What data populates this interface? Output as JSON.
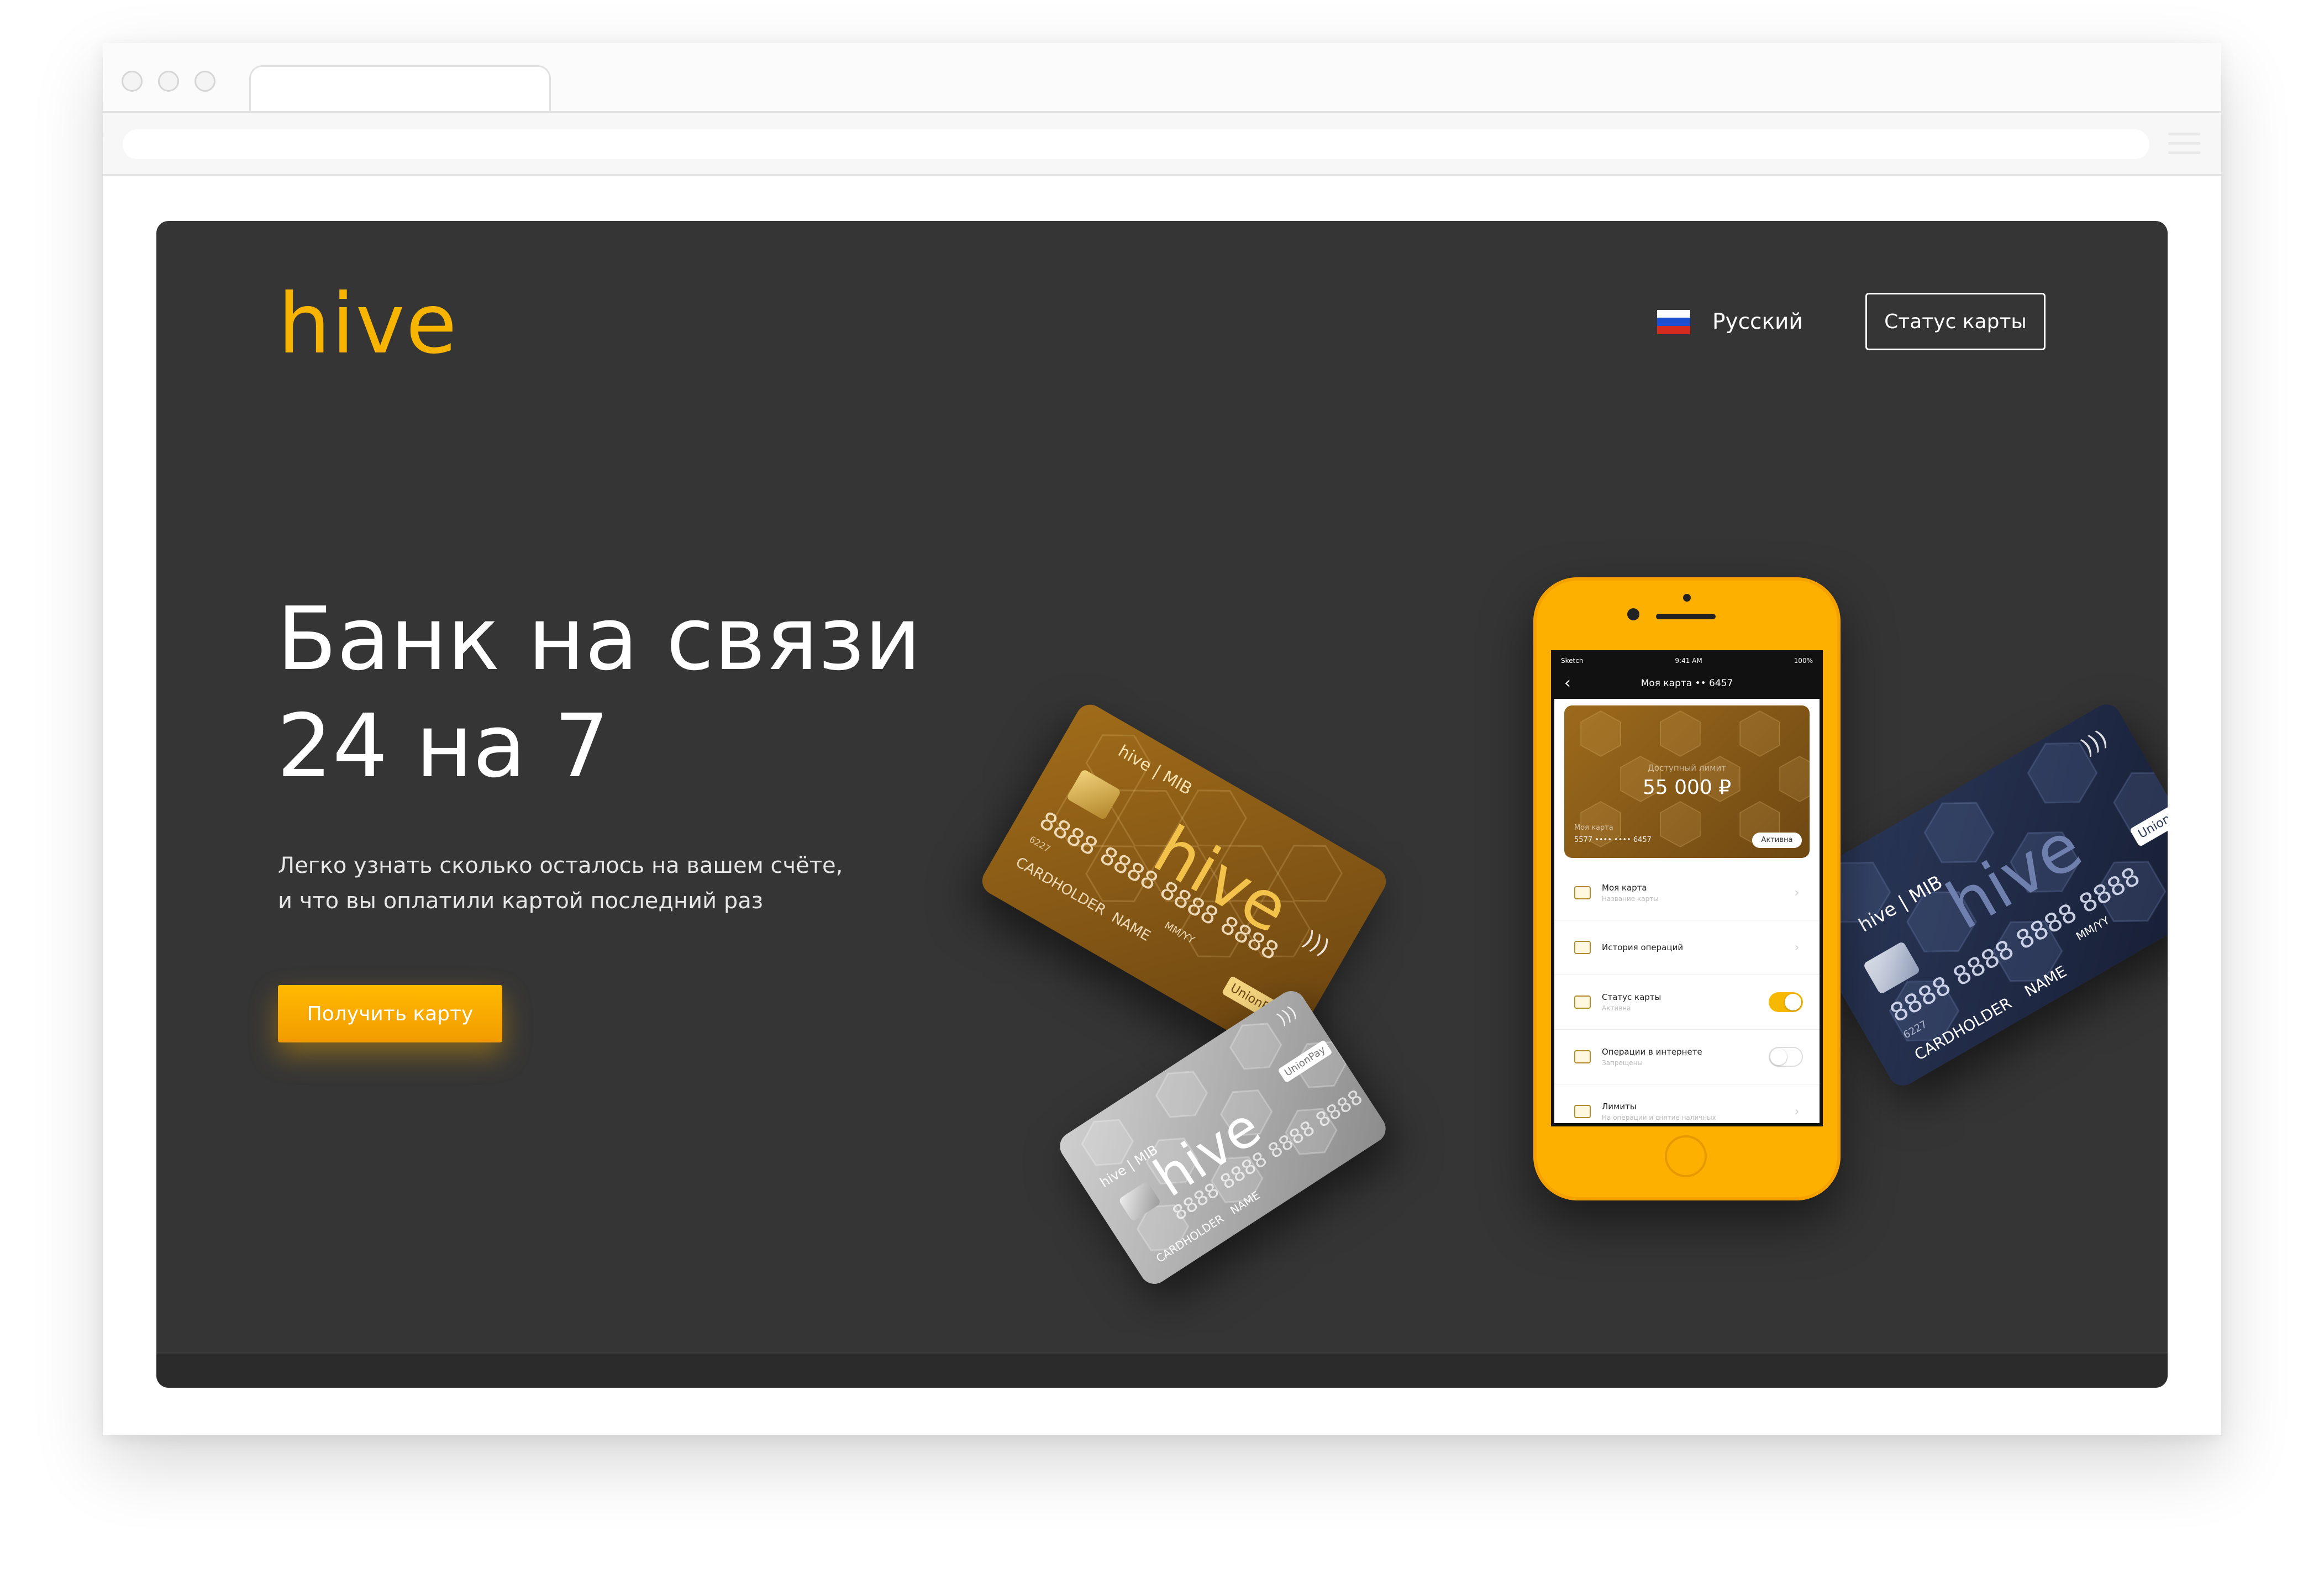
{
  "site": {
    "logo": "hive",
    "language": {
      "label": "Русский",
      "flag_colors": [
        "#ffffff",
        "#1c4fd0",
        "#d52b1e"
      ]
    },
    "status_button": "Статус карты"
  },
  "hero": {
    "headline": "Банк на связи 24 на 7",
    "subtitle_line1": "Легко узнать сколько осталось на вашем счёте,",
    "subtitle_line2": "и что вы оплатили картой последний раз",
    "cta_label": "Получить карту"
  },
  "cards": {
    "brand": "hive",
    "issuer_mark": "hive | MIB",
    "number": "8888 8888 8888 8888",
    "number_prefix": "6227",
    "cardholder": "CARDHOLDER",
    "name": "NAME",
    "expiry": "MM/YY",
    "payment_system": "UnionPay"
  },
  "phone_app": {
    "status_carrier": "Sketch",
    "status_time": "9:41 AM",
    "status_battery": "100%",
    "nav_title": "Моя карта •• 6457",
    "balance_label": "Доступный лимит",
    "balance_amount": "55 000 ₽",
    "card_label": "Моя карта",
    "card_number_masked": "5577 •••• •••• 6457",
    "card_status_badge": "Активна",
    "menu": [
      {
        "title": "Моя карта",
        "subtitle": "Название карты",
        "control": "chevron"
      },
      {
        "title": "История операций",
        "subtitle": "",
        "control": "chevron"
      },
      {
        "title": "Статус карты",
        "subtitle": "Активна",
        "control": "toggle-on"
      },
      {
        "title": "Операции в интернете",
        "subtitle": "Запрещены",
        "control": "toggle-off"
      },
      {
        "title": "Лимиты",
        "subtitle": "На операции и снятие наличных",
        "control": "chevron"
      }
    ]
  },
  "colors": {
    "page_background": "#353535",
    "accent": "#f7b400",
    "cta_gradient": [
      "#ffb900",
      "#f29c00"
    ],
    "phone_body": "#fdb000"
  }
}
